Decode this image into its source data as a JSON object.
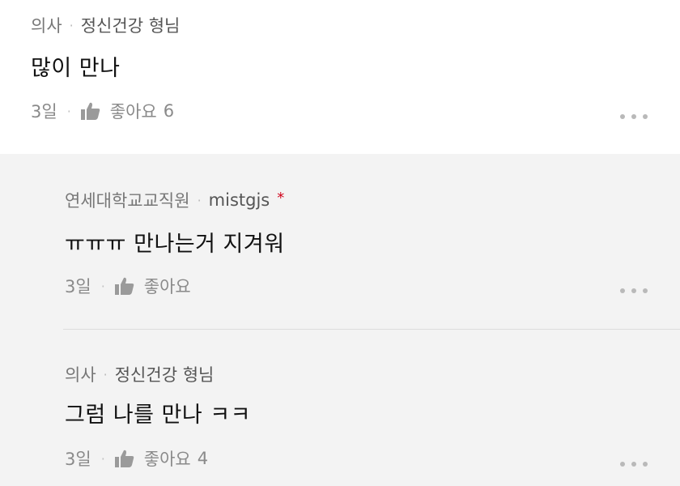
{
  "comments": [
    {
      "org": "의사",
      "nickname": "정신건강 형님",
      "text": "많이 만나",
      "time": "3일",
      "like_label": "좋아요",
      "like_count": "6"
    },
    {
      "org": "연세대학교교직원",
      "nickname": "mistgjs",
      "author_marker": "*",
      "text": "ㅠㅠㅠ 만나는거 지겨워",
      "time": "3일",
      "like_label": "좋아요",
      "like_count": ""
    },
    {
      "org": "의사",
      "nickname": "정신건강 형님",
      "text": "그럼 나를 만나 ㅋㅋ",
      "time": "3일",
      "like_label": "좋아요",
      "like_count": "4"
    }
  ],
  "separator": "·",
  "icons": {
    "like": "thumbs-up-icon",
    "more": "more-horizontal-icon"
  },
  "colors": {
    "author_marker": "#d0021b",
    "reply_background": "#f3f3f3",
    "comment_background": "#ffffff"
  }
}
